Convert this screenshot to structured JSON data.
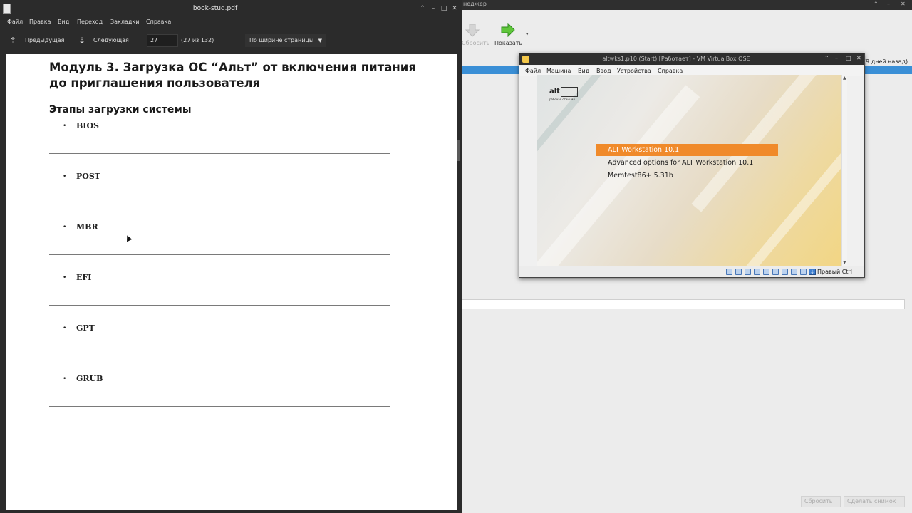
{
  "pdf_viewer": {
    "window_title": "book-stud.pdf",
    "menu": [
      "Файл",
      "Правка",
      "Вид",
      "Переход",
      "Закладки",
      "Справка"
    ],
    "toolbar": {
      "prev_label": "Предыдущая",
      "next_label": "Следующая",
      "page_value": "27",
      "page_count": "(27 из 132)",
      "zoom_label": "По ширине страницы"
    },
    "page": {
      "heading": "Модуль 3. Загрузка ОС “Альт” от включения питания до приглашения пользователя",
      "subheading": "Этапы загрузки системы",
      "stages": [
        "BIOS",
        "POST",
        "MBR",
        "EFI",
        "GPT",
        "GRUB"
      ]
    }
  },
  "vbox_manager": {
    "title_fragment": "неджер",
    "toolbar": {
      "reset_label": "Сбросить",
      "show_label": "Показать"
    },
    "vm_state_fragment": "(9 дней назад)",
    "bottom_buttons": {
      "discard": "Сбросить",
      "snapshot": "Сделать снимок"
    }
  },
  "vm_window": {
    "title": "altwks1.p10 (Start) [Работает] - VM VirtualBox OSE",
    "menu": [
      "Файл",
      "Машина",
      "Вид",
      "Ввод",
      "Устройства",
      "Справка"
    ],
    "screen": {
      "logo_text": "alt",
      "logo_sub": "рабочая станция",
      "boot_entries": [
        {
          "label": "ALT Workstation 10.1",
          "selected": true
        },
        {
          "label": "Advanced options for ALT Workstation 10.1",
          "selected": false
        },
        {
          "label": "Memtest86+ 5.31b",
          "selected": false
        }
      ],
      "accent_color": "#f08a2a"
    },
    "host_key": "Правый Ctrl"
  }
}
